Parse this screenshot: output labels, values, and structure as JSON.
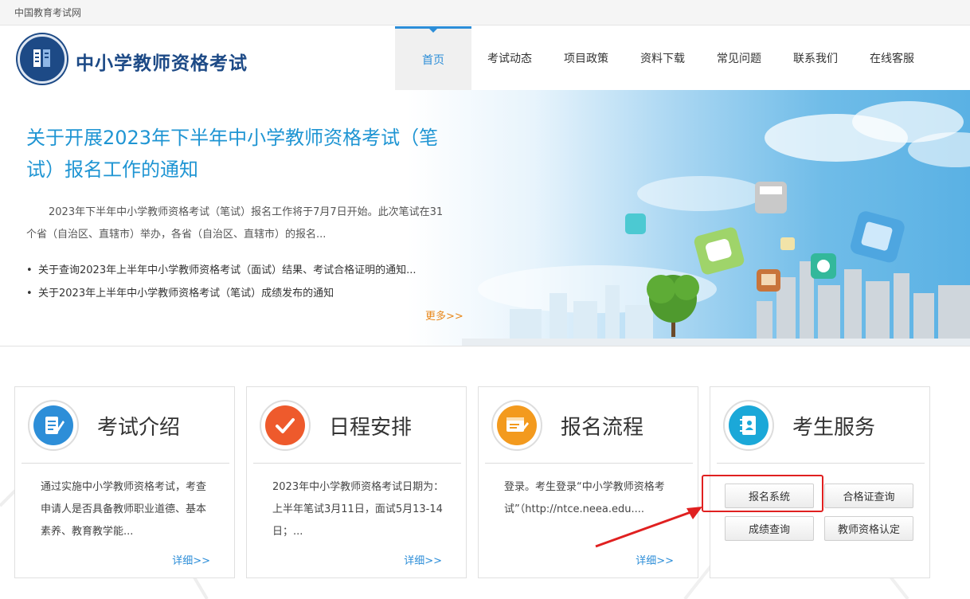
{
  "topbar": {
    "site_name": "中国教育考试网"
  },
  "header": {
    "brand": "中小学教师资格考试",
    "nav": [
      {
        "label": "首页",
        "active": true
      },
      {
        "label": "考试动态",
        "active": false
      },
      {
        "label": "项目政策",
        "active": false
      },
      {
        "label": "资料下载",
        "active": false
      },
      {
        "label": "常见问题",
        "active": false
      },
      {
        "label": "联系我们",
        "active": false
      },
      {
        "label": "在线客服",
        "active": false
      }
    ]
  },
  "banner": {
    "headline": "关于开展2023年下半年中小学教师资格考试（笔试）报名工作的通知",
    "summary": "2023年下半年中小学教师资格考试（笔试）报名工作将于7月7日开始。此次笔试在31个省（自治区、直辖市）举办，各省（自治区、直辖市）的报名...",
    "links": [
      "关于查询2023年上半年中小学教师资格考试（面试）结果、考试合格证明的通知...",
      "关于2023年上半年中小学教师资格考试（笔试）成绩发布的通知"
    ],
    "more": "更多>>"
  },
  "cards": [
    {
      "title": "考试介绍",
      "text": "通过实施中小学教师资格考试，考查申请人是否具备教师职业道德、基本素养、教育教学能...",
      "detail": "详细>>",
      "icon": "document-pen-icon",
      "color": "#2d8ed8"
    },
    {
      "title": "日程安排",
      "text": "2023年中小学教师资格考试日期为：上半年笔试3月11日，面试5月13-14日；...",
      "detail": "详细>>",
      "icon": "checkmark-icon",
      "color": "#ee5a2c"
    },
    {
      "title": "报名流程",
      "text": "登录。考生登录“中小学教师资格考试”（http://ntce.neea.edu....",
      "detail": "详细>>",
      "icon": "form-edit-icon",
      "color": "#f39a1e"
    },
    {
      "title": "考生服务",
      "icon": "contact-book-icon",
      "color": "#1ba8d8",
      "buttons": [
        "报名系统",
        "合格证查询",
        "成绩查询",
        "教师资格认定"
      ]
    }
  ],
  "colors": {
    "accent": "#2d8ed8",
    "brand": "#1d4a86",
    "more": "#e8881b",
    "annotation": "#e02020"
  }
}
